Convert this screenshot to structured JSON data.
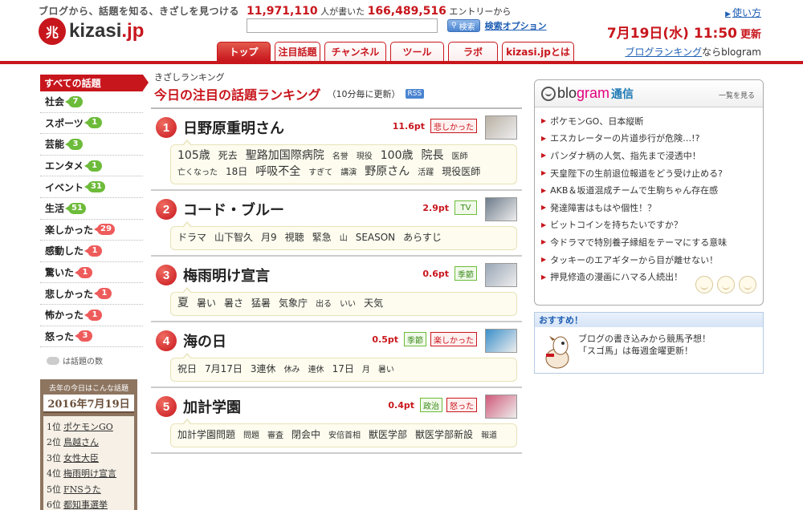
{
  "header": {
    "tagline": "ブログから、話題を知る、きざしを見つける",
    "logo_mark": "兆",
    "logo_text_a": "kizasi",
    "logo_text_b": ".jp",
    "stats_people": "11,971,110",
    "stats_people_label": "人が書いた",
    "stats_entries": "166,489,516",
    "stats_entries_label": "エントリーから",
    "search_value": "",
    "search_button": "検索",
    "search_option": "検索オプション",
    "help_link": "使い方",
    "date": "7月19日(水) 11:50",
    "updated": "更新",
    "tabs": [
      {
        "label": "トップ"
      },
      {
        "label": "注目話題"
      },
      {
        "label": "チャンネル"
      },
      {
        "label": "ツール"
      },
      {
        "label": "ラボ"
      },
      {
        "label": "kizasi.jpとは"
      }
    ],
    "blogram_link": "ブログランキング",
    "blogram_suffix": "ならblogram"
  },
  "categories": {
    "head": "すべての話題",
    "items": [
      {
        "label": "社会",
        "count": "7",
        "color": "g"
      },
      {
        "label": "スポーツ",
        "count": "1",
        "color": "g"
      },
      {
        "label": "芸能",
        "count": "3",
        "color": "g"
      },
      {
        "label": "エンタメ",
        "count": "1",
        "color": "g"
      },
      {
        "label": "イベント",
        "count": "31",
        "color": "g"
      },
      {
        "label": "生活",
        "count": "51",
        "color": "g"
      },
      {
        "label": "楽しかった",
        "count": "29",
        "color": "r"
      },
      {
        "label": "感動した",
        "count": "1",
        "color": "r"
      },
      {
        "label": "驚いた",
        "count": "1",
        "color": "r"
      },
      {
        "label": "悲しかった",
        "count": "1",
        "color": "r"
      },
      {
        "label": "怖かった",
        "count": "1",
        "color": "r"
      },
      {
        "label": "怒った",
        "count": "3",
        "color": "r"
      }
    ],
    "legend": "は話題の数"
  },
  "last_year": {
    "caption": "去年の今日はこんな話題",
    "date": "2016年7月19日",
    "items": [
      {
        "rank": "1位",
        "label": "ポケモンGO"
      },
      {
        "rank": "2位",
        "label": "鳥越さん"
      },
      {
        "rank": "3位",
        "label": "女性大臣"
      },
      {
        "rank": "4位",
        "label": "梅雨明け宣言"
      },
      {
        "rank": "5位",
        "label": "FNSうた"
      },
      {
        "rank": "6位",
        "label": "都知事選挙"
      }
    ]
  },
  "ranking": {
    "subtitle": "きざしランキング",
    "title": "今日の注目の話題ランキング",
    "note": "（10分毎に更新）",
    "rss": "RSS",
    "items": [
      {
        "num": "1",
        "word": "日野原重明さん",
        "points": "11.6pt",
        "tags": [
          {
            "label": "悲しかった",
            "style": "red"
          }
        ],
        "thumb": "#b9b0a4",
        "keywords": [
          {
            "t": "105歳",
            "s": 3
          },
          {
            "t": "死去",
            "s": 2
          },
          {
            "t": "聖路加国際病院",
            "s": 3
          },
          {
            "t": "名誉",
            "s": 1
          },
          {
            "t": "現役",
            "s": 1
          },
          {
            "t": "100歳",
            "s": 3
          },
          {
            "t": "院長",
            "s": 3
          },
          {
            "t": "医師",
            "s": 1
          },
          {
            "t": "亡くなった",
            "s": 1
          },
          {
            "t": "18日",
            "s": 2
          },
          {
            "t": "呼吸不全",
            "s": 3
          },
          {
            "t": "すぎて",
            "s": 1
          },
          {
            "t": "講演",
            "s": 1
          },
          {
            "t": "野原さん",
            "s": 3
          },
          {
            "t": "活躍",
            "s": 1
          },
          {
            "t": "現役医師",
            "s": 2
          }
        ]
      },
      {
        "num": "2",
        "word": "コード・ブルー",
        "points": "2.9pt",
        "tags": [
          {
            "label": "TV",
            "style": "green"
          }
        ],
        "thumb": "#6d7b8a",
        "keywords": [
          {
            "t": "ドラマ",
            "s": 2
          },
          {
            "t": "山下智久",
            "s": 2
          },
          {
            "t": "月9",
            "s": 2
          },
          {
            "t": "視聴",
            "s": 2
          },
          {
            "t": "緊急",
            "s": 2
          },
          {
            "t": "山",
            "s": 1
          },
          {
            "t": "SEASON",
            "s": 2
          },
          {
            "t": "あらすじ",
            "s": 2
          }
        ]
      },
      {
        "num": "3",
        "word": "梅雨明け宣言",
        "points": "0.6pt",
        "tags": [
          {
            "label": "季節",
            "style": "green"
          }
        ],
        "thumb": "#9aa6b6",
        "keywords": [
          {
            "t": "夏",
            "s": 3
          },
          {
            "t": "暑い",
            "s": 2
          },
          {
            "t": "暑さ",
            "s": 2
          },
          {
            "t": "猛暑",
            "s": 2
          },
          {
            "t": "気象庁",
            "s": 2
          },
          {
            "t": "出る",
            "s": 1
          },
          {
            "t": "いい",
            "s": 1
          },
          {
            "t": "天気",
            "s": 2
          }
        ]
      },
      {
        "num": "4",
        "word": "海の日",
        "points": "0.5pt",
        "tags": [
          {
            "label": "季節",
            "style": "green"
          },
          {
            "label": "楽しかった",
            "style": "red"
          }
        ],
        "thumb": "#3a8fc9",
        "keywords": [
          {
            "t": "祝日",
            "s": 2
          },
          {
            "t": "7月17日",
            "s": 2
          },
          {
            "t": "3連休",
            "s": 2
          },
          {
            "t": "休み",
            "s": 1
          },
          {
            "t": "連休",
            "s": 1
          },
          {
            "t": "17日",
            "s": 2
          },
          {
            "t": "月",
            "s": 1
          },
          {
            "t": "暑い",
            "s": 1
          }
        ]
      },
      {
        "num": "5",
        "word": "加計学園",
        "points": "0.4pt",
        "tags": [
          {
            "label": "政治",
            "style": "green"
          },
          {
            "label": "怒った",
            "style": "red"
          }
        ],
        "thumb": "#d05a7a",
        "keywords": [
          {
            "t": "加計学園問題",
            "s": 2
          },
          {
            "t": "問題",
            "s": 1
          },
          {
            "t": "審査",
            "s": 1
          },
          {
            "t": "閉会中",
            "s": 2
          },
          {
            "t": "安倍首相",
            "s": 1
          },
          {
            "t": "獣医学部",
            "s": 2
          },
          {
            "t": "獣医学部新設",
            "s": 2
          },
          {
            "t": "報道",
            "s": 1
          }
        ]
      }
    ]
  },
  "blogram": {
    "logo_a": "blo",
    "logo_b": "gram",
    "logo_c": "通信",
    "more": "一覧を見る",
    "items": [
      "ポケモンGO、日本縦断",
      "エスカレーターの片道歩行が危険…!?",
      "パンダナ柄の人気、指先まで浸透中！",
      "天皇陛下の生前退位報道をどう受け止める?",
      "AKB＆坂道混成チームで生駒ちゃん存在感",
      "発達障害はもはや個性！？",
      "ビットコインを持ちたいですか？",
      "今ドラマで特別養子縁組をテーマにする意味",
      "タッキーのエアギターから目が離せない！",
      "押見修造の漫画にハマる人続出！"
    ]
  },
  "recommend": {
    "head": "おすすめ！",
    "line1": "ブログの書き込みから競馬予想！",
    "line2": "「スゴ馬」は毎週金曜更新！"
  }
}
